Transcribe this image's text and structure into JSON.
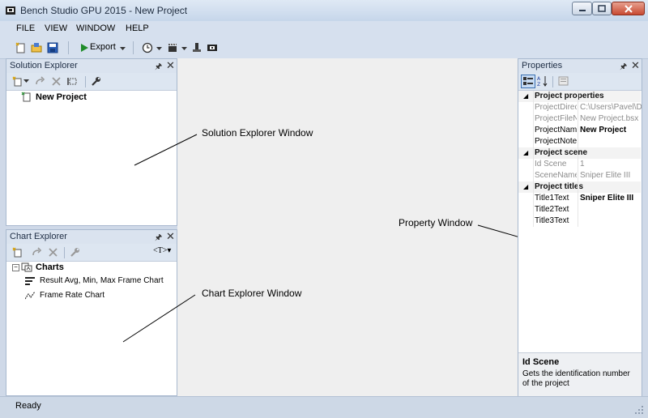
{
  "window": {
    "title": "Bench Studio GPU 2015 - New Project",
    "controls": [
      "minimize-icon",
      "maximize-icon",
      "close-icon"
    ]
  },
  "menu": [
    "FILE",
    "VIEW",
    "WINDOW",
    "HELP"
  ],
  "toolbar": {
    "export_label": "Export",
    "icons": [
      "new-project-icon",
      "open-icon",
      "save-icon",
      "play-icon",
      "clock-icon",
      "clapper-icon",
      "benchmark-icon",
      "camera-icon"
    ]
  },
  "solution_explorer": {
    "title": "Solution Explorer",
    "project": "New Project",
    "annotation": "Solution Explorer Window"
  },
  "chart_explorer": {
    "title": "Chart Explorer",
    "root": "Charts",
    "items": [
      "Result Avg, Min, Max Frame Chart",
      "Frame Rate Chart"
    ],
    "annotation": "Chart Explorer Window",
    "type_button": "T"
  },
  "properties": {
    "title": "Properties",
    "annotation": "Property Window",
    "categories": [
      {
        "name": "Project properties",
        "rows": [
          {
            "name": "ProjectDirec",
            "value": "C:\\Users\\Pavel\\De",
            "style": "dim"
          },
          {
            "name": "ProjectFileN",
            "value": "New Project.bsx",
            "style": "dim"
          },
          {
            "name": "ProjectName",
            "value": "New Project",
            "style": "bold"
          },
          {
            "name": "ProjectNote",
            "value": "",
            "style": "normal"
          }
        ]
      },
      {
        "name": "Project scene",
        "rows": [
          {
            "name": "Id Scene",
            "value": "1",
            "style": "dim"
          },
          {
            "name": "SceneName",
            "value": "Sniper Elite III",
            "style": "dim"
          }
        ]
      },
      {
        "name": "Project titles",
        "rows": [
          {
            "name": "Title1Text",
            "value": "Sniper Elite III",
            "style": "bold"
          },
          {
            "name": "Title2Text",
            "value": "",
            "style": "normal"
          },
          {
            "name": "Title3Text",
            "value": "",
            "style": "normal"
          }
        ]
      }
    ],
    "description_title": "Id Scene",
    "description_text": "Gets the identification number of the project"
  },
  "status": "Ready"
}
